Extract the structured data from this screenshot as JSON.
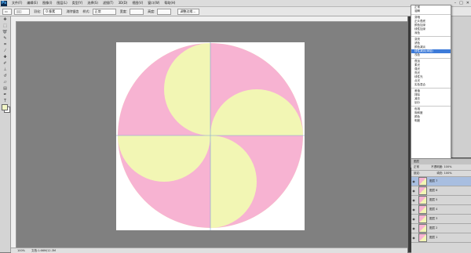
{
  "menubar": {
    "logo": "Ps",
    "items": [
      "文件(F)",
      "编辑(E)",
      "图像(I)",
      "图层(L)",
      "类型(Y)",
      "选择(S)",
      "滤镜(T)",
      "3D(D)",
      "视图(V)",
      "窗口(W)",
      "帮助(H)"
    ],
    "window_controls": [
      "–",
      "□",
      "✕"
    ]
  },
  "options": {
    "feather_label": "羽化:",
    "feather_value": "0 像素",
    "antialias_label": "消除锯齿",
    "style_label": "样式:",
    "style_value": "正常",
    "width_label": "宽度:",
    "height_label": "高度:",
    "refine_label": "调整边缘..."
  },
  "colors": {
    "pink": "#f7b3d2",
    "yellow": "#f2f6b4",
    "canvas_bg": "#808080",
    "selection": "#3d7bd9"
  },
  "context_menu": {
    "groups": [
      [
        "正常",
        "溶解"
      ],
      [
        "变暗",
        "正片叠底",
        "颜色加深",
        "线性加深",
        "深色"
      ],
      [
        "变亮",
        "滤色",
        "颜色减淡",
        "线性减淡(添加)",
        "浅色"
      ],
      [
        "叠加",
        "柔光",
        "强光",
        "亮光",
        "线性光",
        "点光",
        "实色混合"
      ],
      [
        "差值",
        "排除",
        "减去",
        "划分"
      ],
      [
        "色相",
        "饱和度",
        "颜色",
        "明度"
      ]
    ],
    "selected": "线性减淡(添加)"
  },
  "layers_panel": {
    "title": "图层",
    "blend_mode": "正常",
    "opacity_label": "不透明度:",
    "opacity_value": "100%",
    "lock_label": "锁定:",
    "fill_label": "填充:",
    "fill_value": "100%",
    "layers": [
      {
        "name": "图层 7",
        "active": true
      },
      {
        "name": "图层 6",
        "active": false
      },
      {
        "name": "图层 5",
        "active": false
      },
      {
        "name": "图层 4",
        "active": false
      },
      {
        "name": "图层 3",
        "active": false
      },
      {
        "name": "图层 2",
        "active": false
      },
      {
        "name": "图层 1",
        "active": false
      }
    ]
  },
  "status": {
    "zoom": "100%",
    "doc_info": "文档:1.66M/12.3M"
  }
}
